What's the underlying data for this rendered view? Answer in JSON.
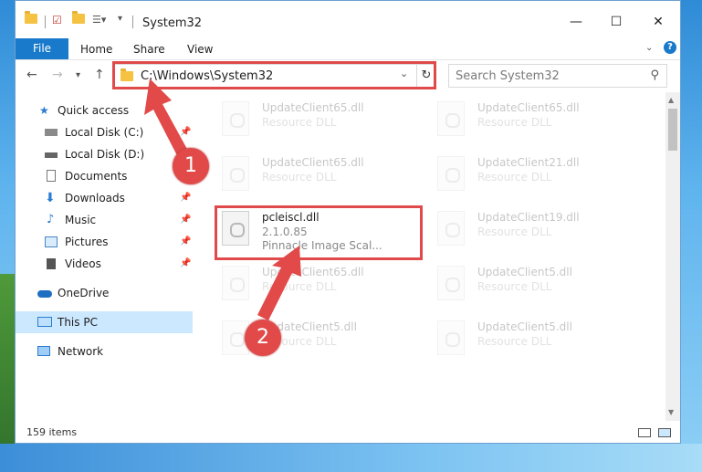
{
  "window": {
    "title": "System32",
    "controls": {
      "minimize": "—",
      "maximize": "☐",
      "close": "✕"
    }
  },
  "ribbon": {
    "tabs": [
      "File",
      "Home",
      "Share",
      "View"
    ],
    "help": "?"
  },
  "address": {
    "path": "C:\\Windows\\System32"
  },
  "search": {
    "placeholder": "Search System32"
  },
  "sidebar": {
    "items": [
      {
        "label": "Quick access",
        "pinned": false
      },
      {
        "label": "Local Disk (C:)",
        "pinned": true
      },
      {
        "label": "Local Disk (D:)",
        "pinned": false
      },
      {
        "label": "Documents",
        "pinned": true
      },
      {
        "label": "Downloads",
        "pinned": true
      },
      {
        "label": "Music",
        "pinned": true
      },
      {
        "label": "Pictures",
        "pinned": true
      },
      {
        "label": "Videos",
        "pinned": true
      },
      {
        "label": "OneDrive",
        "pinned": false
      },
      {
        "label": "This PC",
        "pinned": false,
        "selected": true
      },
      {
        "label": "Network",
        "pinned": false
      }
    ]
  },
  "files": {
    "left": [
      {
        "name": "UpdateClient65.dll",
        "desc": "Resource DLL"
      },
      {
        "name": "UpdateClient65.dll",
        "desc": "Resource DLL"
      },
      {
        "name": "pcleiscl.dll",
        "version": "2.1.0.85",
        "desc": "Pinnacle Image Scal..."
      },
      {
        "name": "UpdateClient65.dll",
        "desc": "Resource DLL"
      },
      {
        "name": "UpdateClient5.dll",
        "desc": "Resource DLL"
      }
    ],
    "right": [
      {
        "name": "UpdateClient65.dll",
        "desc": "Resource DLL"
      },
      {
        "name": "UpdateClient21.dll",
        "desc": "Resource DLL"
      },
      {
        "name": "UpdateClient19.dll",
        "desc": "Resource DLL"
      },
      {
        "name": "UpdateClient5.dll",
        "desc": "Resource DLL"
      },
      {
        "name": "UpdateClient5.dll",
        "desc": "Resource DLL"
      }
    ]
  },
  "status": {
    "count": "159 items"
  },
  "annotations": {
    "step1": "1",
    "step2": "2",
    "color": "#e04a4a"
  }
}
